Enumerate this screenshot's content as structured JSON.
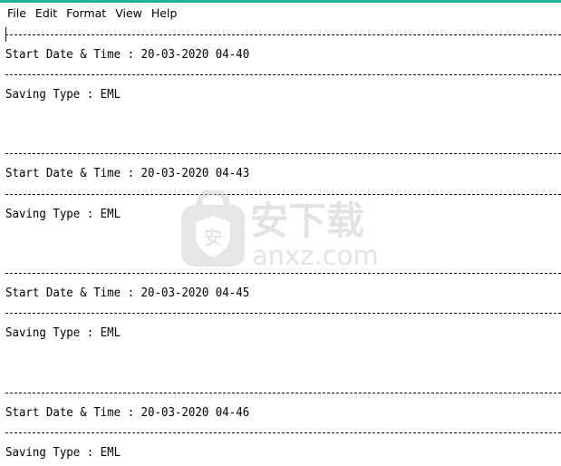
{
  "menu": {
    "file": "File",
    "edit": "Edit",
    "format": "Format",
    "view": "View",
    "help": "Help"
  },
  "log": {
    "separator": "----------------------------------------------------------------------------------------------------",
    "entries": [
      {
        "start": "Start Date & Time : 20-03-2020 04-40",
        "saving": "Saving Type : EML"
      },
      {
        "start": "Start Date & Time : 20-03-2020 04-43",
        "saving": "Saving Type : EML"
      },
      {
        "start": "Start Date & Time : 20-03-2020 04-45",
        "saving": "Saving Type : EML"
      },
      {
        "start": "Start Date & Time : 20-03-2020 04-46",
        "saving": "Saving Type : EML"
      }
    ]
  },
  "watermark": {
    "cn_text": "安下载",
    "site": "anxz.com",
    "badge": "安",
    "color": "#c8c8c8"
  },
  "colors": {
    "accent": "#1fb39a"
  }
}
